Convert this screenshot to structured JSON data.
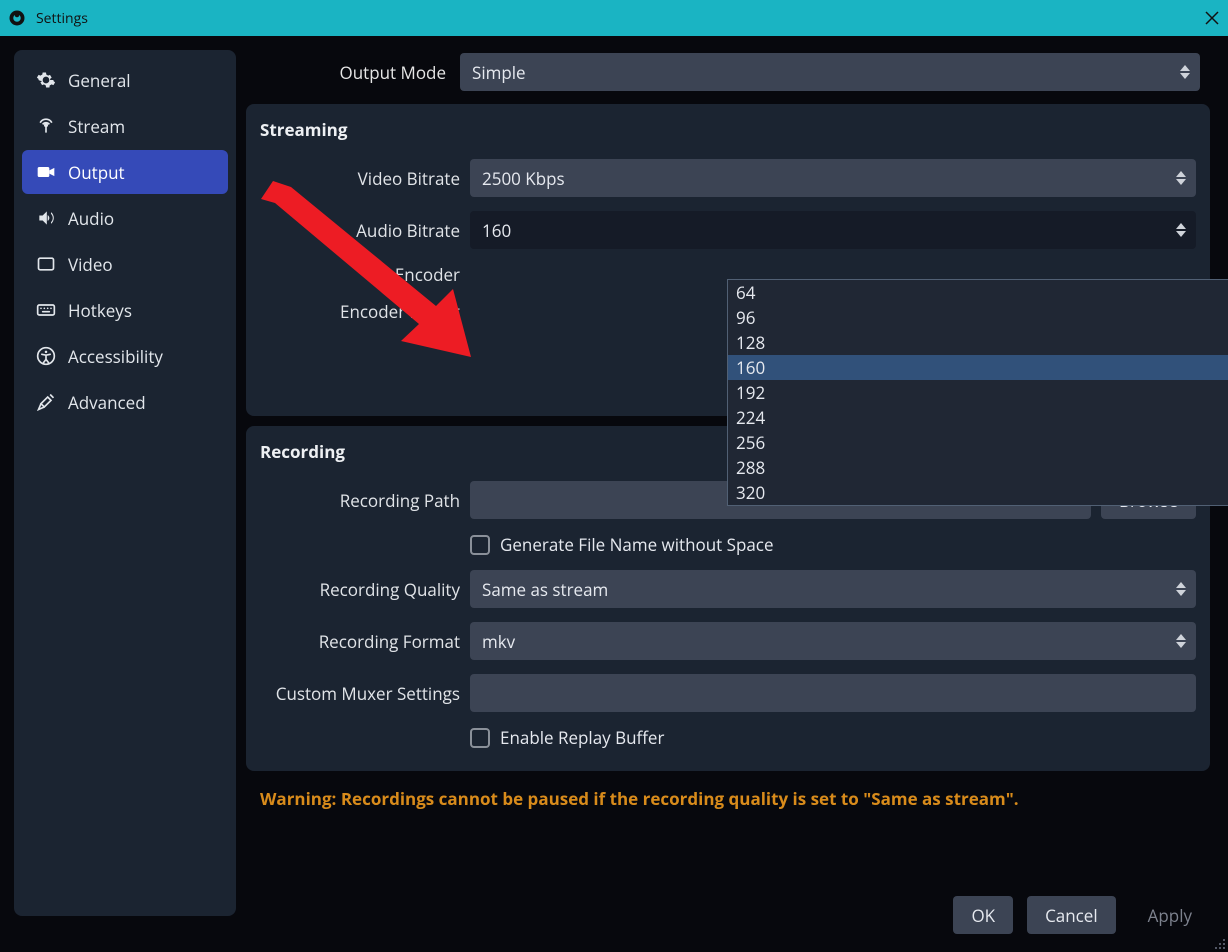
{
  "window": {
    "title": "Settings"
  },
  "sidebar": {
    "items": [
      {
        "label": "General"
      },
      {
        "label": "Stream"
      },
      {
        "label": "Output"
      },
      {
        "label": "Audio"
      },
      {
        "label": "Video"
      },
      {
        "label": "Hotkeys"
      },
      {
        "label": "Accessibility"
      },
      {
        "label": "Advanced"
      }
    ],
    "active_index": 2
  },
  "output_mode": {
    "label": "Output Mode",
    "value": "Simple"
  },
  "streaming": {
    "title": "Streaming",
    "video_bitrate": {
      "label": "Video Bitrate",
      "value": "2500 Kbps"
    },
    "audio_bitrate": {
      "label": "Audio Bitrate",
      "value": "160",
      "options": [
        "64",
        "96",
        "128",
        "160",
        "192",
        "224",
        "256",
        "288",
        "320"
      ]
    },
    "encoder": {
      "label": "Encoder"
    },
    "encoder_preset": {
      "label": "Encoder Preset"
    }
  },
  "recording": {
    "title": "Recording",
    "recording_path": {
      "label": "Recording Path",
      "value": "",
      "browse": "Browse"
    },
    "generate_no_space": {
      "label": "Generate File Name without Space",
      "checked": false
    },
    "recording_quality": {
      "label": "Recording Quality",
      "value": "Same as stream"
    },
    "recording_format": {
      "label": "Recording Format",
      "value": "mkv"
    },
    "custom_muxer": {
      "label": "Custom Muxer Settings",
      "value": ""
    },
    "enable_replay_buffer": {
      "label": "Enable Replay Buffer",
      "checked": false
    }
  },
  "warning": "Warning: Recordings cannot be paused if the recording quality is set to \"Same as stream\".",
  "buttons": {
    "ok": "OK",
    "cancel": "Cancel",
    "apply": "Apply"
  }
}
